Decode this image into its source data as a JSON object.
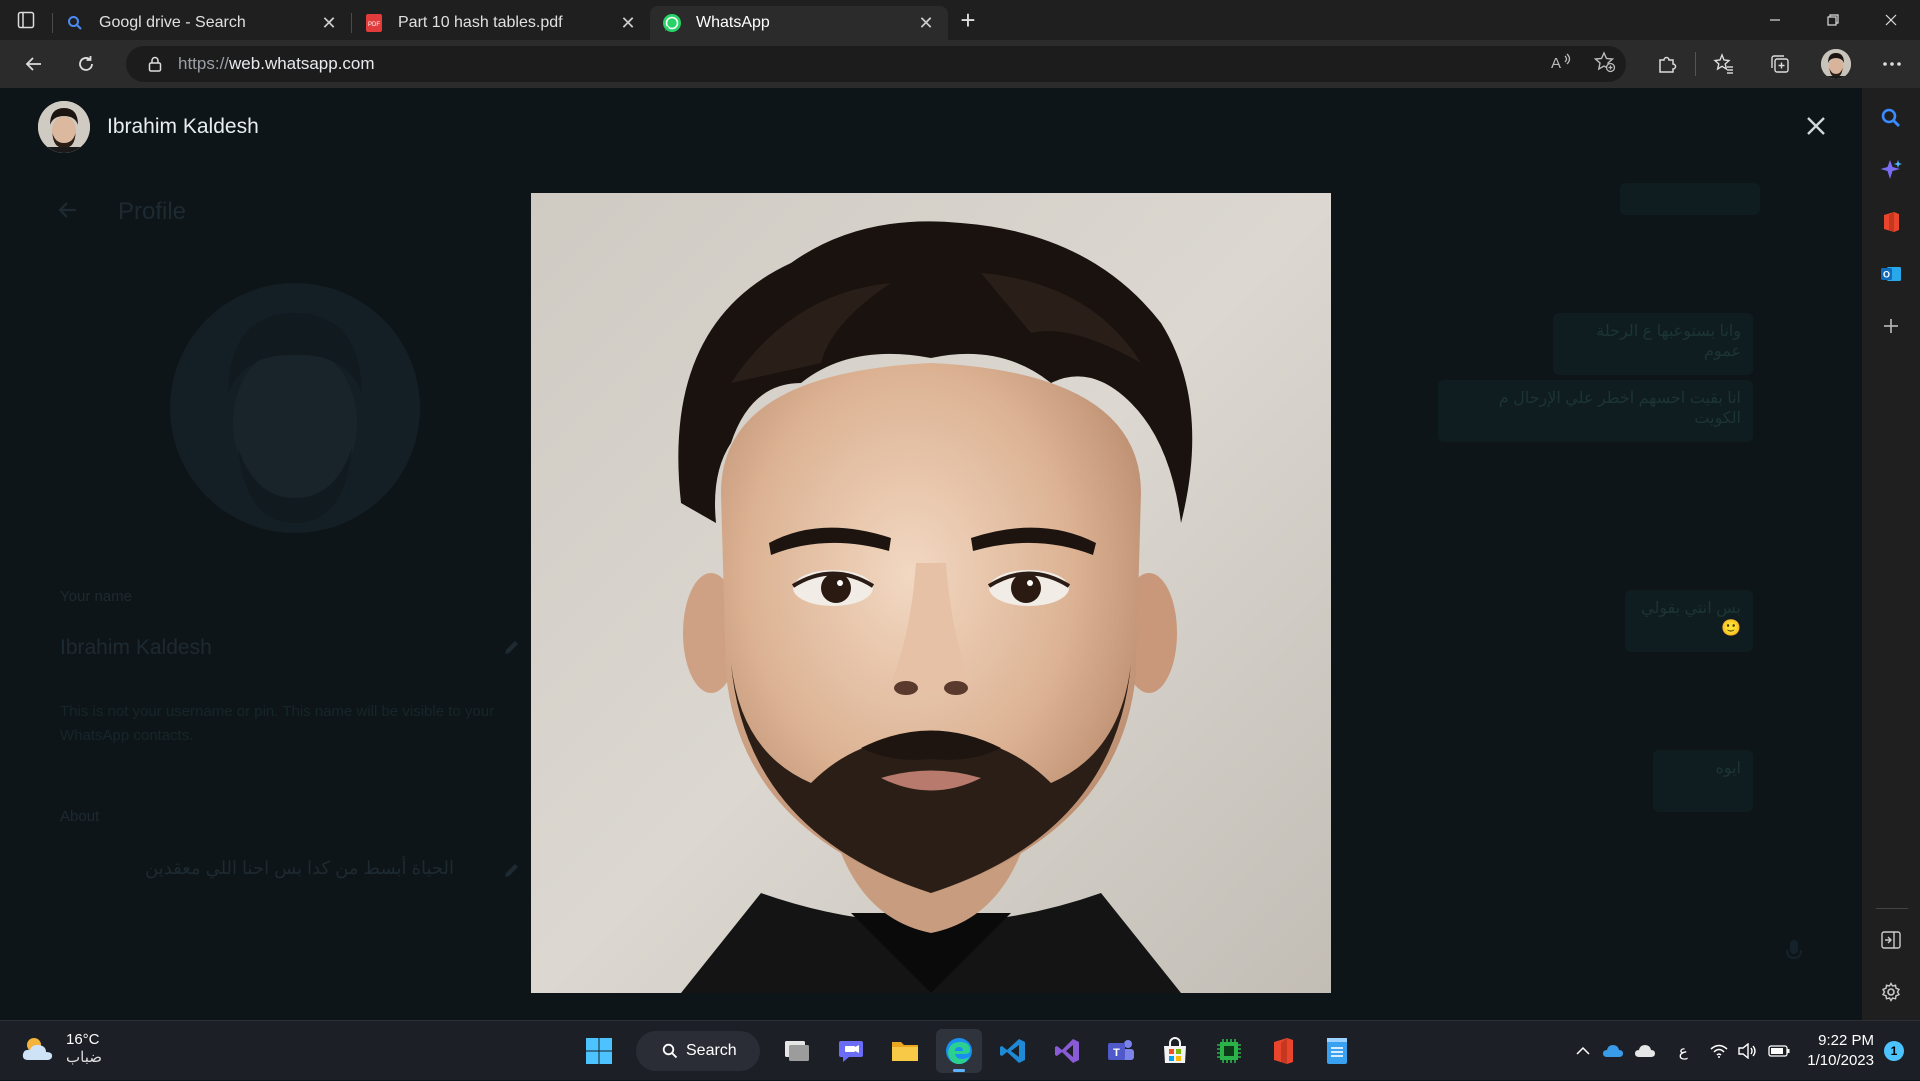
{
  "browser": {
    "tabs": [
      {
        "title": "Googl drive - Search",
        "favicon": "search-icon",
        "active": false
      },
      {
        "title": "Part 10 hash tables.pdf",
        "favicon": "pdf-icon",
        "active": false
      },
      {
        "title": "WhatsApp",
        "favicon": "whatsapp-icon",
        "active": true
      }
    ],
    "url_scheme": "https://",
    "url_host": "web.whatsapp.com"
  },
  "viewer": {
    "contact_name": "Ibrahim Kaldesh"
  },
  "background_panel": {
    "title": "Profile",
    "name": "Ibrahim Kaldesh",
    "name_hint": "This is not your username or pin. This name will be visible to your WhatsApp contacts.",
    "about_label": "About",
    "about": "الحياة أبسط من كدا بس احنا اللي معقدين",
    "messages": [
      "وانا بستوعبها ع الرحلة عموم",
      "انا بقيت احسهم اخطر علي الإرحال م الكويت",
      "بس انتي بقولي 🙂",
      "ايوه"
    ]
  },
  "colors": {
    "accent_whatsapp": "#25d366",
    "edge_search": "#3b8cff",
    "taskbar_bg": "#1c1f26"
  },
  "taskbar": {
    "temperature": "16°C",
    "weather_condition": "ضباب",
    "search_label": "Search",
    "input_language": "ع",
    "time": "9:22 PM",
    "date": "1/10/2023",
    "notification_count": "1"
  }
}
